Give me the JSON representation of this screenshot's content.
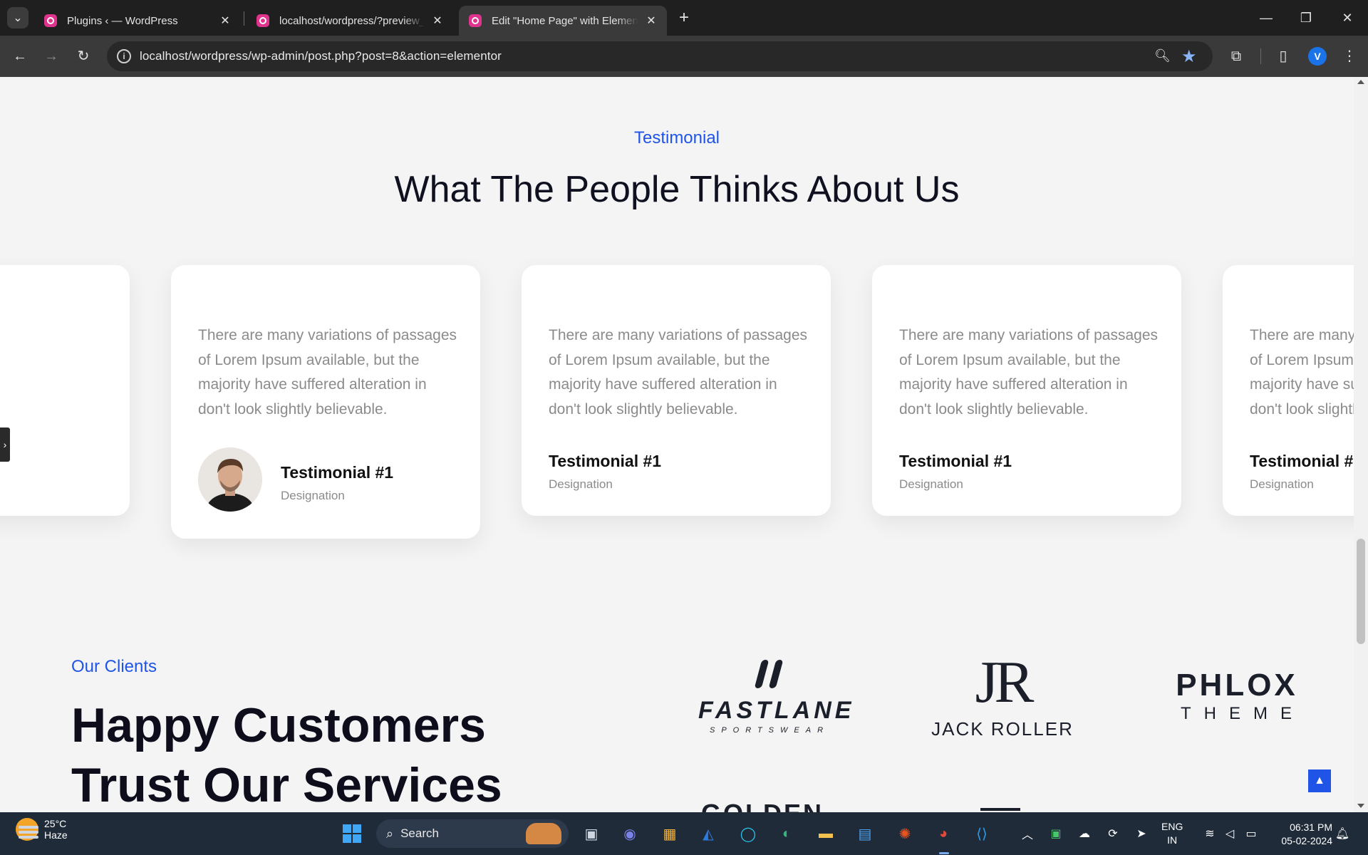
{
  "browser": {
    "tabs": [
      {
        "title": "Plugins ‹ — WordPress",
        "active": false
      },
      {
        "title": "localhost/wordpress/?preview_i",
        "active": false
      },
      {
        "title": "Edit \"Home Page\" with Element",
        "active": true
      }
    ],
    "url": "localhost/wordpress/wp-admin/post.php?post=8&action=elementor",
    "profile_initial": "V",
    "icons": [
      "tab-search-icon",
      "back-icon",
      "forward-icon",
      "reload-icon",
      "site-info-icon",
      "zoom-icon",
      "bookmark-star-icon",
      "extensions-icon",
      "side-panel-icon",
      "menu-icon",
      "minimize-icon",
      "restore-icon",
      "close-icon"
    ]
  },
  "testimonials": {
    "eyebrow": "Testimonial",
    "heading": "What The People Thinks About Us",
    "quote": "There are many variations of passages of Lorem Ipsum available, but the majority have suffered alteration in don't look slightly believable.",
    "name": "Testimonial #1",
    "designation": "Designation",
    "slider_arrow": "›"
  },
  "clients": {
    "eyebrow": "Our Clients",
    "heading_line1": "Happy Customers",
    "heading_line2": "Trust Our Services",
    "logos": {
      "fastlane_word": "FASTLANE",
      "fastlane_sub": "SPORTSWEAR",
      "jr_mono": "JR",
      "jr_word": "JACK ROLLER",
      "phlox_word": "PHLOX",
      "phlox_sub": "THEME",
      "partial_word": "GOLDEN"
    },
    "back_to_top": "▲"
  },
  "taskbar": {
    "temperature": "25°C",
    "condition": "Haze",
    "search_label": "Search",
    "language_line1": "ENG",
    "language_line2": "IN",
    "time": "06:31 PM",
    "date": "05-02-2024",
    "accent": "#1f54e6"
  }
}
